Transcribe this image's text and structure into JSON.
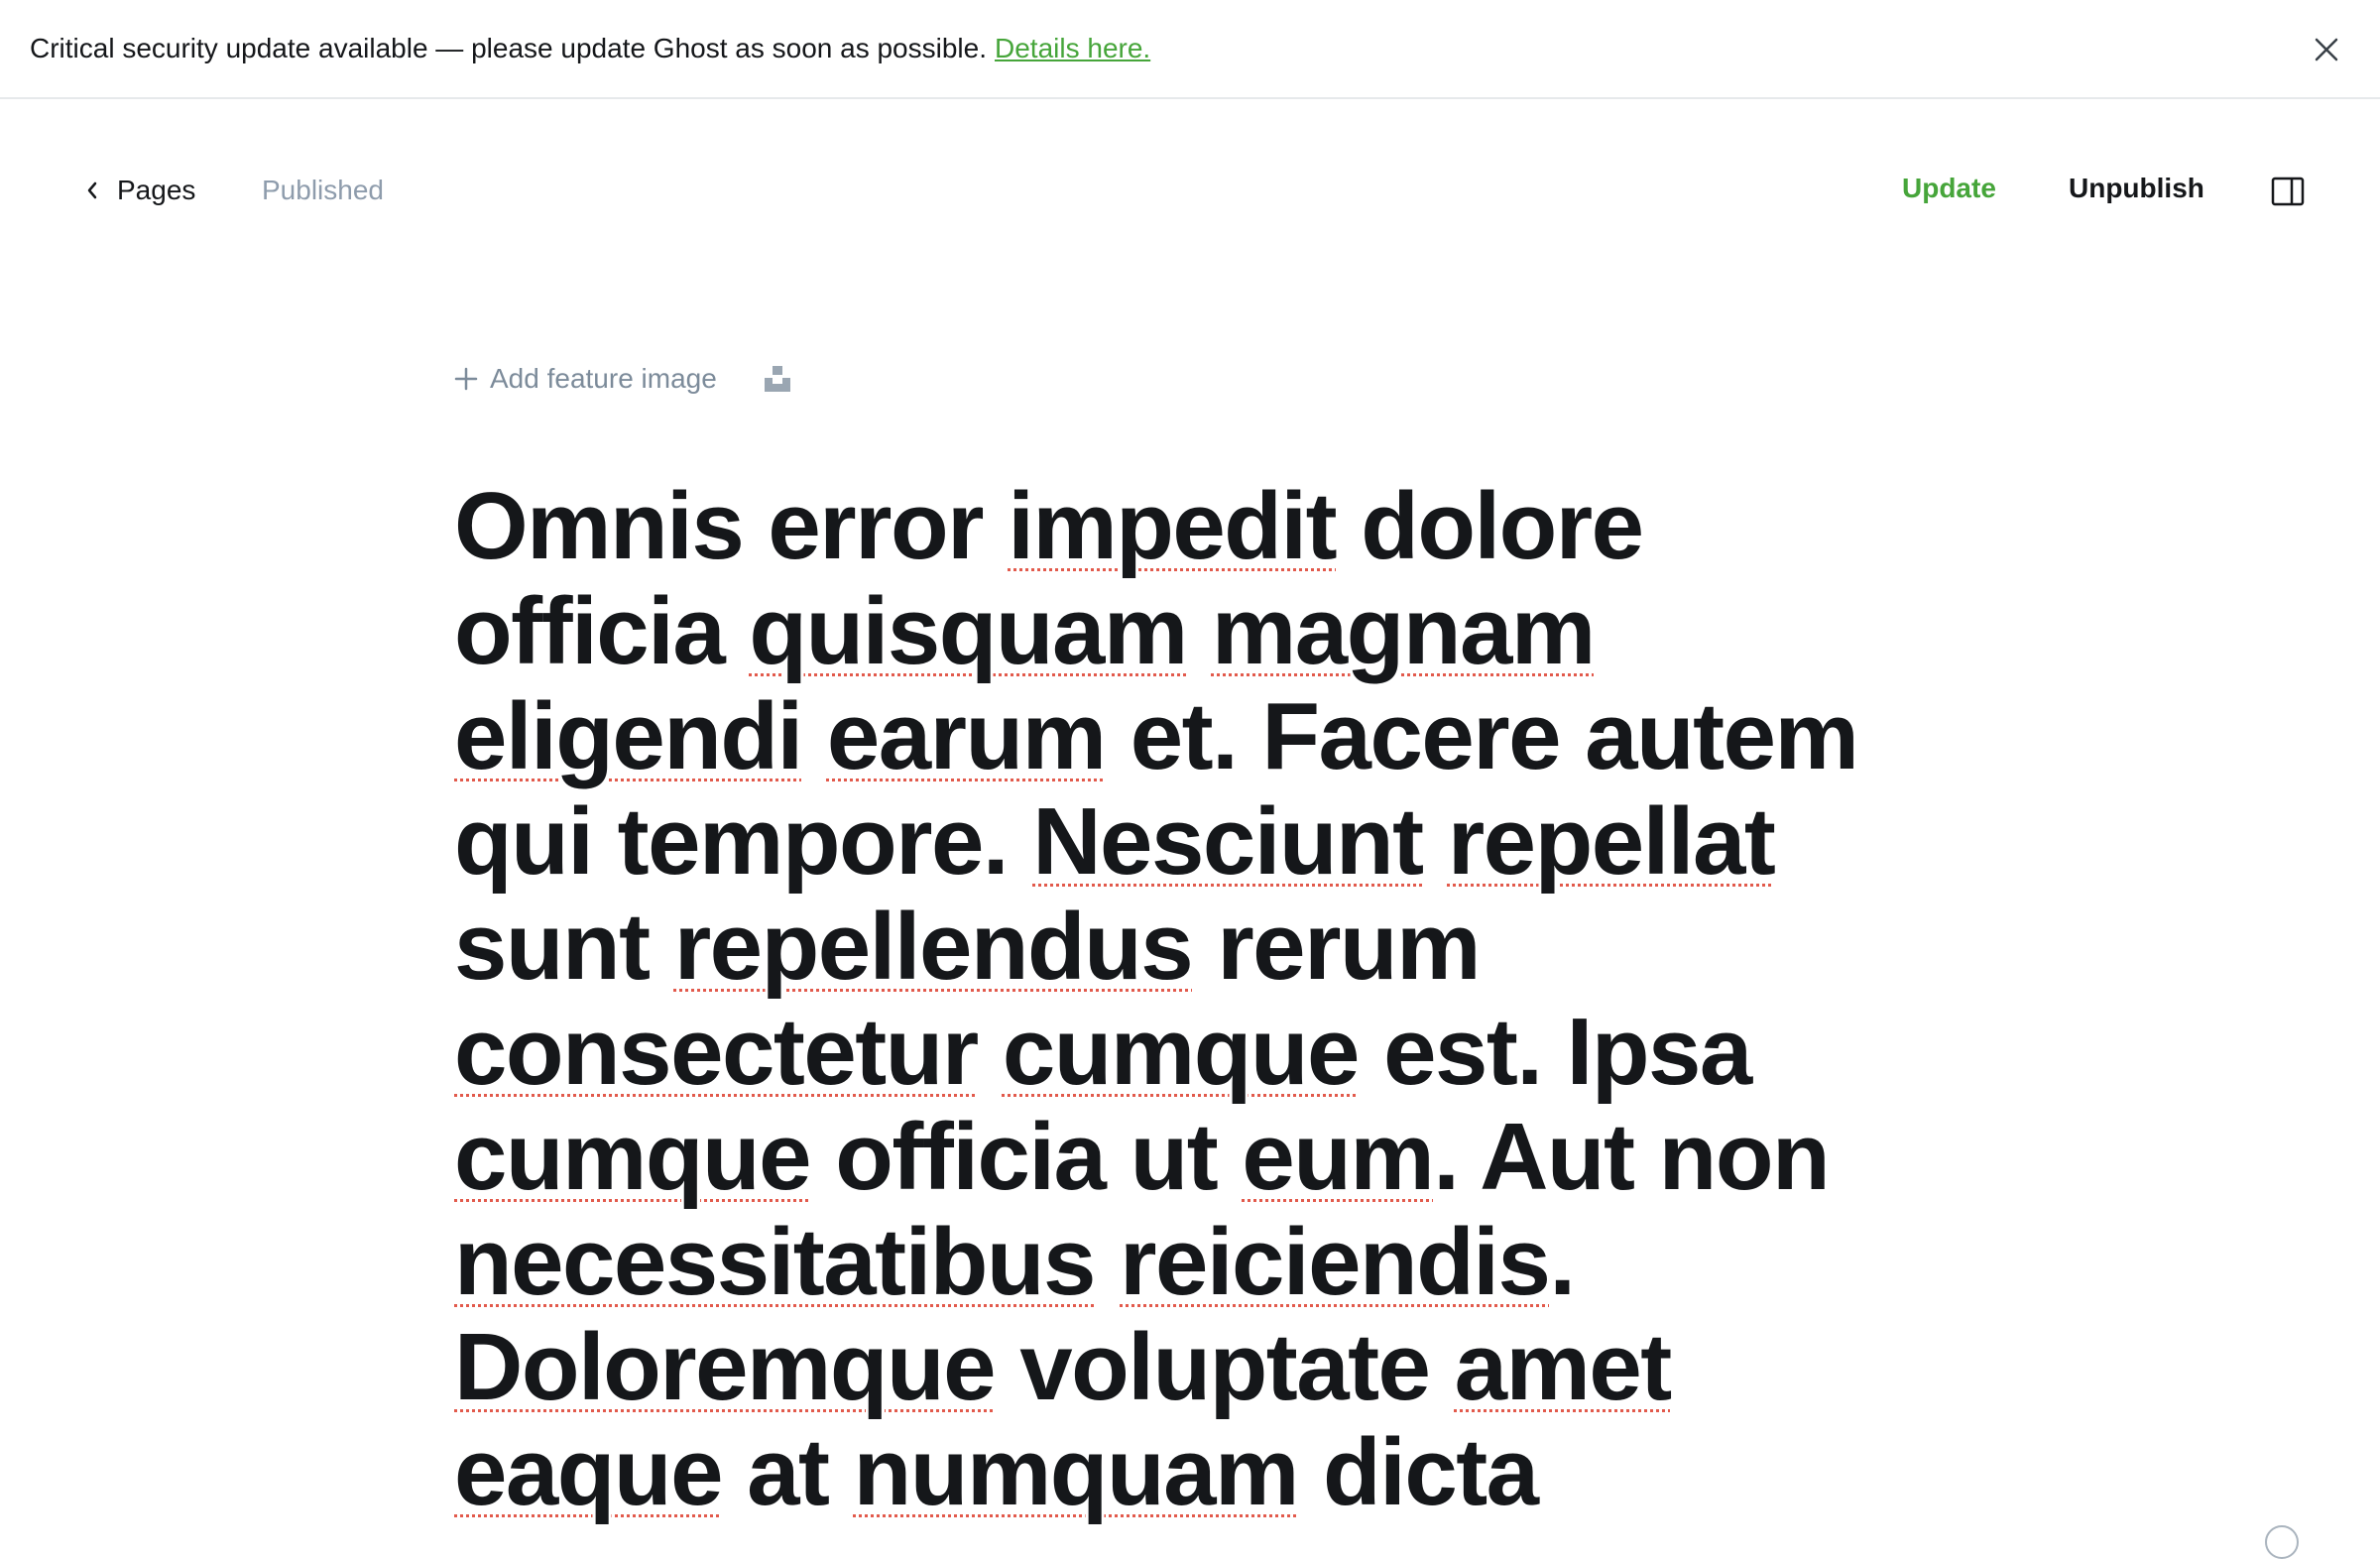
{
  "banner": {
    "message": "Critical security update available — please update Ghost as soon as possible.",
    "link_label": "Details here.",
    "close_icon": "close-icon"
  },
  "header": {
    "back_label": "Pages",
    "status": "Published",
    "update_label": "Update",
    "unpublish_label": "Unpublish",
    "sidebar_icon": "sidebar-toggle-icon",
    "accent_color": "#46a53a"
  },
  "feature": {
    "add_label": "Add feature image",
    "unsplash_icon": "unsplash-icon"
  },
  "post": {
    "title_parts": [
      {
        "t": "Omnis error ",
        "s": false
      },
      {
        "t": "impedit",
        "s": true
      },
      {
        "t": " dolore officia ",
        "s": false
      },
      {
        "t": "quisquam",
        "s": true
      },
      {
        "t": " ",
        "s": false
      },
      {
        "t": "magnam",
        "s": true
      },
      {
        "t": " ",
        "s": false
      },
      {
        "t": "eligendi",
        "s": true
      },
      {
        "t": " ",
        "s": false
      },
      {
        "t": "earum",
        "s": true
      },
      {
        "t": " et. Facere autem qui tempore. ",
        "s": false
      },
      {
        "t": "Nesciunt",
        "s": true
      },
      {
        "t": " ",
        "s": false
      },
      {
        "t": "repellat",
        "s": true
      },
      {
        "t": " sunt ",
        "s": false
      },
      {
        "t": "repellendus",
        "s": true
      },
      {
        "t": " rerum ",
        "s": false
      },
      {
        "t": "consectetur",
        "s": true
      },
      {
        "t": " ",
        "s": false
      },
      {
        "t": "cumque",
        "s": true
      },
      {
        "t": " est. Ipsa ",
        "s": false
      },
      {
        "t": "cumque",
        "s": true
      },
      {
        "t": " officia ut ",
        "s": false
      },
      {
        "t": "eum",
        "s": true
      },
      {
        "t": ". Aut non ",
        "s": false
      },
      {
        "t": "necessitatibus",
        "s": true
      },
      {
        "t": " ",
        "s": false
      },
      {
        "t": "reiciendis",
        "s": true
      },
      {
        "t": ". ",
        "s": false
      },
      {
        "t": "Doloremque",
        "s": true
      },
      {
        "t": " voluptate ",
        "s": false
      },
      {
        "t": "amet",
        "s": true
      },
      {
        "t": " ",
        "s": false
      },
      {
        "t": "eaque",
        "s": true
      },
      {
        "t": " at ",
        "s": false
      },
      {
        "t": "numquam",
        "s": true
      },
      {
        "t": " dicta",
        "s": false
      }
    ]
  }
}
